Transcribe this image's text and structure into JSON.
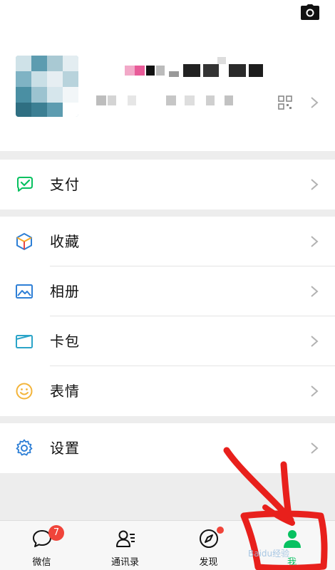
{
  "profile": {
    "camera_icon": "camera-icon",
    "qr_icon": "qr-code-icon",
    "chevron_icon": "chevron-right-icon",
    "avatar_colors": [
      "#4a8fa3",
      "#7fb3c4",
      "#c9dfe6",
      "#2f6f82",
      "#a8cbd6",
      "#5d9cb0",
      "#e6eef2"
    ]
  },
  "menu_groups": [
    {
      "items": [
        {
          "label": "支付",
          "icon": "wallet-check-icon",
          "color": "#07c160"
        }
      ]
    },
    {
      "items": [
        {
          "label": "收藏",
          "icon": "favorites-cube-icon",
          "color": "#f9a825"
        },
        {
          "label": "相册",
          "icon": "album-icon",
          "color": "#2e7fd6"
        },
        {
          "label": "卡包",
          "icon": "card-wallet-icon",
          "color": "#2ba4c8"
        },
        {
          "label": "表情",
          "icon": "emoji-smile-icon",
          "color": "#f3b43a"
        }
      ]
    },
    {
      "items": [
        {
          "label": "设置",
          "icon": "gear-icon",
          "color": "#2e7fd6"
        }
      ]
    }
  ],
  "tabbar": {
    "tabs": [
      {
        "label": "微信",
        "icon": "chat-bubble-icon",
        "badge": "7"
      },
      {
        "label": "通讯录",
        "icon": "contacts-icon"
      },
      {
        "label": "发现",
        "icon": "compass-icon",
        "dot": true
      },
      {
        "label": "我",
        "icon": "person-icon",
        "active": true
      }
    ],
    "active_color": "#07c160",
    "badge_color": "#f0443a"
  },
  "watermark": "Baidu经验"
}
